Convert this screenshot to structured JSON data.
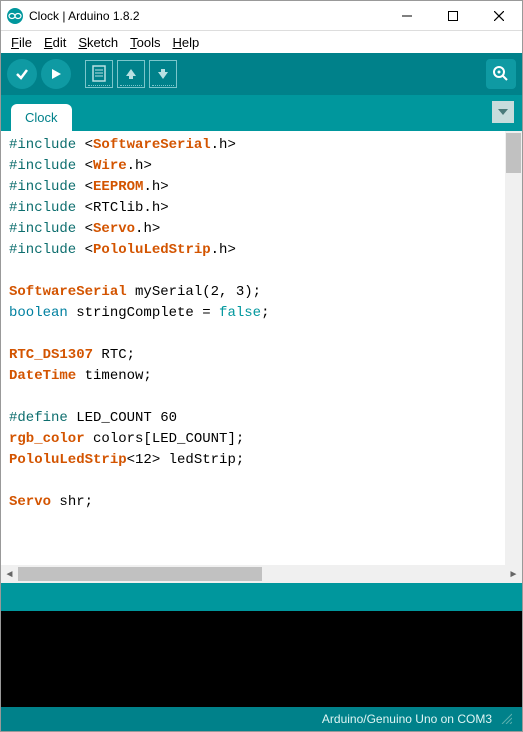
{
  "window": {
    "title": "Clock | Arduino 1.8.2"
  },
  "menu": {
    "file": "File",
    "edit": "Edit",
    "sketch": "Sketch",
    "tools": "Tools",
    "help": "Help"
  },
  "tabs": {
    "active": "Clock"
  },
  "code": {
    "lines": [
      {
        "type": "include",
        "pre": "#include",
        "lt": "<",
        "lib": "SoftwareSerial",
        "suf": ".h>"
      },
      {
        "type": "include",
        "pre": "#include",
        "lt": "<",
        "lib": "Wire",
        "suf": ".h>"
      },
      {
        "type": "include",
        "pre": "#include",
        "lt": "<",
        "lib": "EEPROM",
        "suf": ".h>"
      },
      {
        "type": "include_plain",
        "pre": "#include",
        "lt": "<RTClib.h>"
      },
      {
        "type": "include",
        "pre": "#include",
        "lt": "<",
        "lib": "Servo",
        "suf": ".h>"
      },
      {
        "type": "include",
        "pre": "#include",
        "lt": "<",
        "lib": "PololuLedStrip",
        "suf": ".h>"
      },
      {
        "type": "blank"
      },
      {
        "type": "decl",
        "kw": "SoftwareSerial",
        "rest": " mySerial(2, 3);"
      },
      {
        "type": "bool_decl",
        "kw": "boolean",
        "mid": " stringComplete = ",
        "val": "false",
        "end": ";"
      },
      {
        "type": "blank"
      },
      {
        "type": "decl",
        "kw": "RTC_DS1307",
        "rest": " RTC;"
      },
      {
        "type": "decl",
        "kw": "DateTime",
        "rest": " timenow;"
      },
      {
        "type": "blank"
      },
      {
        "type": "define",
        "kw": "#define",
        "rest": " LED_COUNT 60"
      },
      {
        "type": "decl",
        "kw": "rgb_color",
        "rest": " colors[LED_COUNT];"
      },
      {
        "type": "decl",
        "kw": "PololuLedStrip",
        "rest": "<12> ledStrip;"
      },
      {
        "type": "blank"
      },
      {
        "type": "decl",
        "kw": "Servo",
        "rest": " shr;"
      }
    ]
  },
  "footer": {
    "board": "Arduino/Genuino Uno on COM3"
  },
  "colors": {
    "toolbar": "#00818a",
    "tabbar": "#00979d",
    "accent": "#d35400"
  }
}
